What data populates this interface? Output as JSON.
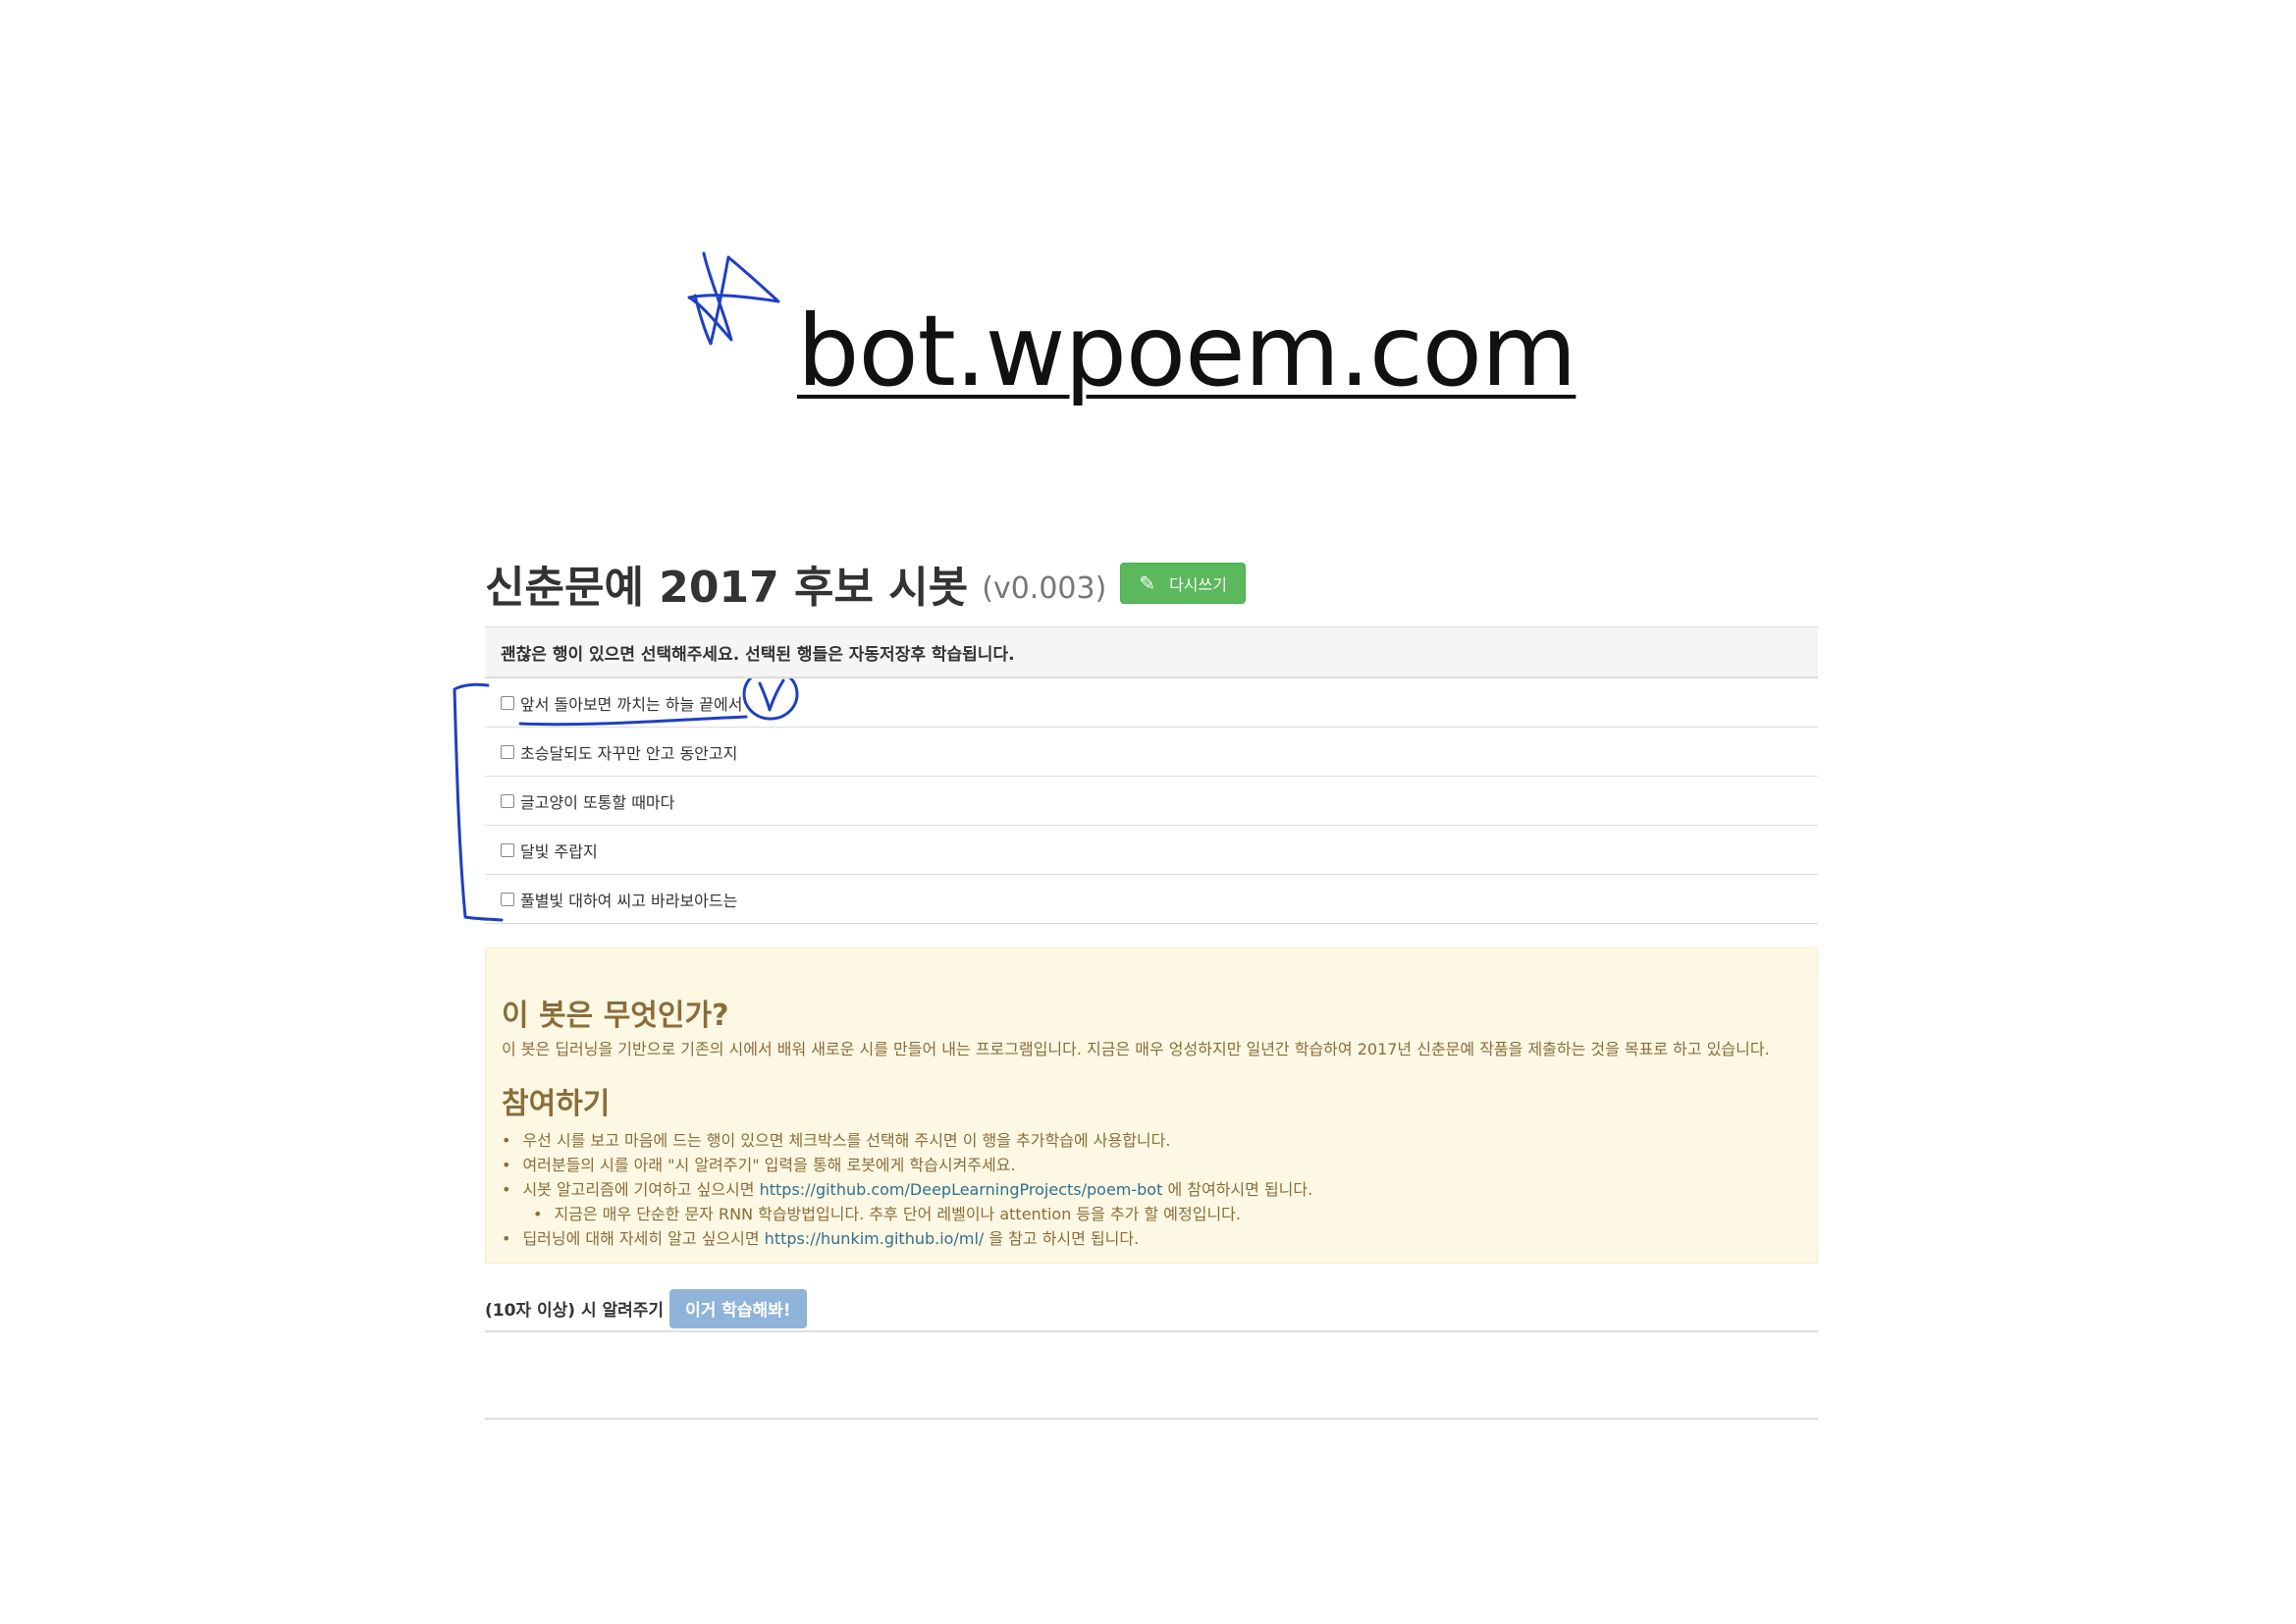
{
  "site": {
    "url": "bot.wpoem.com"
  },
  "header": {
    "title": "신춘문예 2017 후보 시봇",
    "version": "(v0.003)",
    "rewrite_button": "다시쓰기",
    "pencil_icon": "pencil-icon"
  },
  "table": {
    "header": "괜찮은 행이 있으면 선택해주세요. 선택된 행들은 자동저장후 학습됩니다.",
    "rows": [
      "앞서 돌아보면 까치는 하늘 끝에서",
      "초승달되도 자꾸만 안고 동안고지",
      "글고양이 또통할 때마다",
      "달빛 주랍지",
      "풀별빛 대하여 씨고 바라보아드는"
    ]
  },
  "info": {
    "heading": "이 봇은 무엇인가?",
    "description": "이 봇은 딥러닝을 기반으로 기존의 시에서 배워 새로운 시를 만들어 내는 프로그램입니다. 지금은 매우 엉성하지만 일년간 학습하여 2017년 신춘문예 작품을 제출하는 것을 목표로 하고 있습니다.",
    "participate_heading": "참여하기",
    "items": [
      {
        "before": "우선 시를 보고 마음에 드는 행이 있으면 체크박스를 선택해 주시면 이 행을 추가학습에 사용합니다."
      },
      {
        "before": "여러분들의 시를 아래 \"시 알려주기\" 입력을 통해 로봇에게 학습시켜주세요."
      },
      {
        "before": "시봇 알고리즘에 기여하고 싶으시면 ",
        "link": "https://github.com/DeepLearningProjects/poem-bot",
        "after": " 에 참여하시면 됩니다."
      },
      {
        "before": "지금은 매우 단순한 문자 RNN 학습방법입니다. 추후 단어 레벨이나 attention 등을 추가 할 예정입니다."
      },
      {
        "before": "딥러닝에 대해 자세히 알고 싶으시면 ",
        "link": "https://hunkim.github.io/ml/",
        "after": " 을 참고 하시면 됩니다."
      }
    ]
  },
  "submit": {
    "label": "(10자 이상) 시 알려주기",
    "button": "이거 학습해봐!"
  },
  "colors": {
    "ink": "#1f3fc4",
    "success_green": "#5cb85c",
    "panel_yellow": "#fcf8e3",
    "panel_text": "#8a6d3b",
    "link_blue": "#31708f",
    "learn_button": "#8fb3d9"
  }
}
